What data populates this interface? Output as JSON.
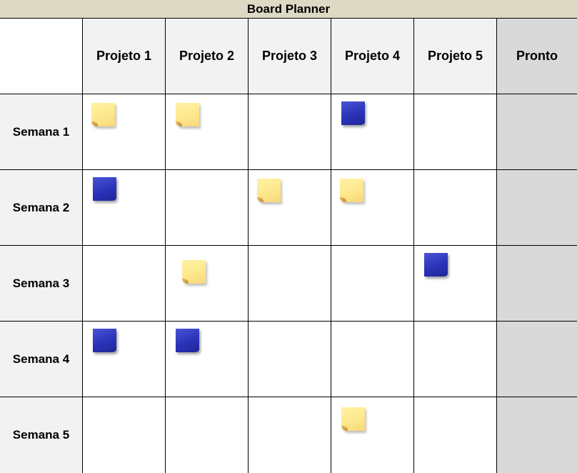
{
  "title": "Board Planner",
  "columns": [
    "Projeto 1",
    "Projeto 2",
    "Projeto 3",
    "Projeto 4",
    "Projeto 5",
    "Pronto"
  ],
  "rows": [
    "Semana 1",
    "Semana 2",
    "Semana 3",
    "Semana 4",
    "Semana 5"
  ],
  "colors": {
    "title_bg": "#ddd9c4",
    "header_bg": "#f2f2f2",
    "done_bg": "#d9d9d9",
    "note_yellow": "#fde68a",
    "note_blue": "#2a33b8"
  },
  "notes": [
    {
      "row": 0,
      "col": 0,
      "color": "yellow"
    },
    {
      "row": 0,
      "col": 1,
      "color": "yellow"
    },
    {
      "row": 0,
      "col": 3,
      "color": "blue"
    },
    {
      "row": 1,
      "col": 0,
      "color": "blue"
    },
    {
      "row": 1,
      "col": 2,
      "color": "yellow"
    },
    {
      "row": 1,
      "col": 3,
      "color": "yellow"
    },
    {
      "row": 2,
      "col": 1,
      "color": "yellow"
    },
    {
      "row": 2,
      "col": 4,
      "color": "blue"
    },
    {
      "row": 3,
      "col": 0,
      "color": "blue"
    },
    {
      "row": 3,
      "col": 1,
      "color": "blue"
    },
    {
      "row": 4,
      "col": 3,
      "color": "yellow"
    }
  ]
}
